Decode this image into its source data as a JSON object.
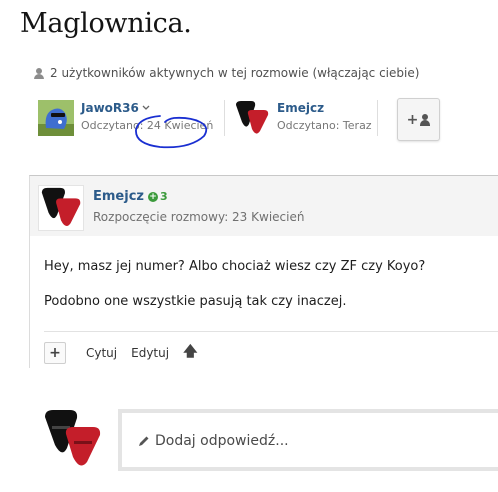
{
  "page": {
    "title": "Maglownica."
  },
  "conversation": {
    "active_users_text": "2 użytkowników aktywnych w tej rozmowie (włączając ciebie)",
    "participants": [
      {
        "name": "JawoR36",
        "seen": "Odczytano: 24 Kwiecień",
        "has_menu": true
      },
      {
        "name": "Emejcz",
        "seen": "Odczytano: Teraz",
        "has_menu": false
      }
    ],
    "invite_icon": "add-user-icon"
  },
  "message": {
    "author": "Emejcz",
    "reputation": "3",
    "started": "Rozpoczęcie rozmowy: 23 Kwiecień",
    "body": [
      "Hey, masz jej numer? Albo chociaż wiesz czy ZF czy Koyo?",
      "Podobno one wszystkie pasują tak czy inaczej."
    ],
    "actions": {
      "plus": "+",
      "quote": "Cytuj",
      "edit": "Edytuj"
    }
  },
  "reply": {
    "placeholder": "Dodaj odpowiedź..."
  },
  "colors": {
    "link": "#2c5b8a",
    "reputation": "#3b9a3b",
    "annotation": "#1a2fd1"
  }
}
